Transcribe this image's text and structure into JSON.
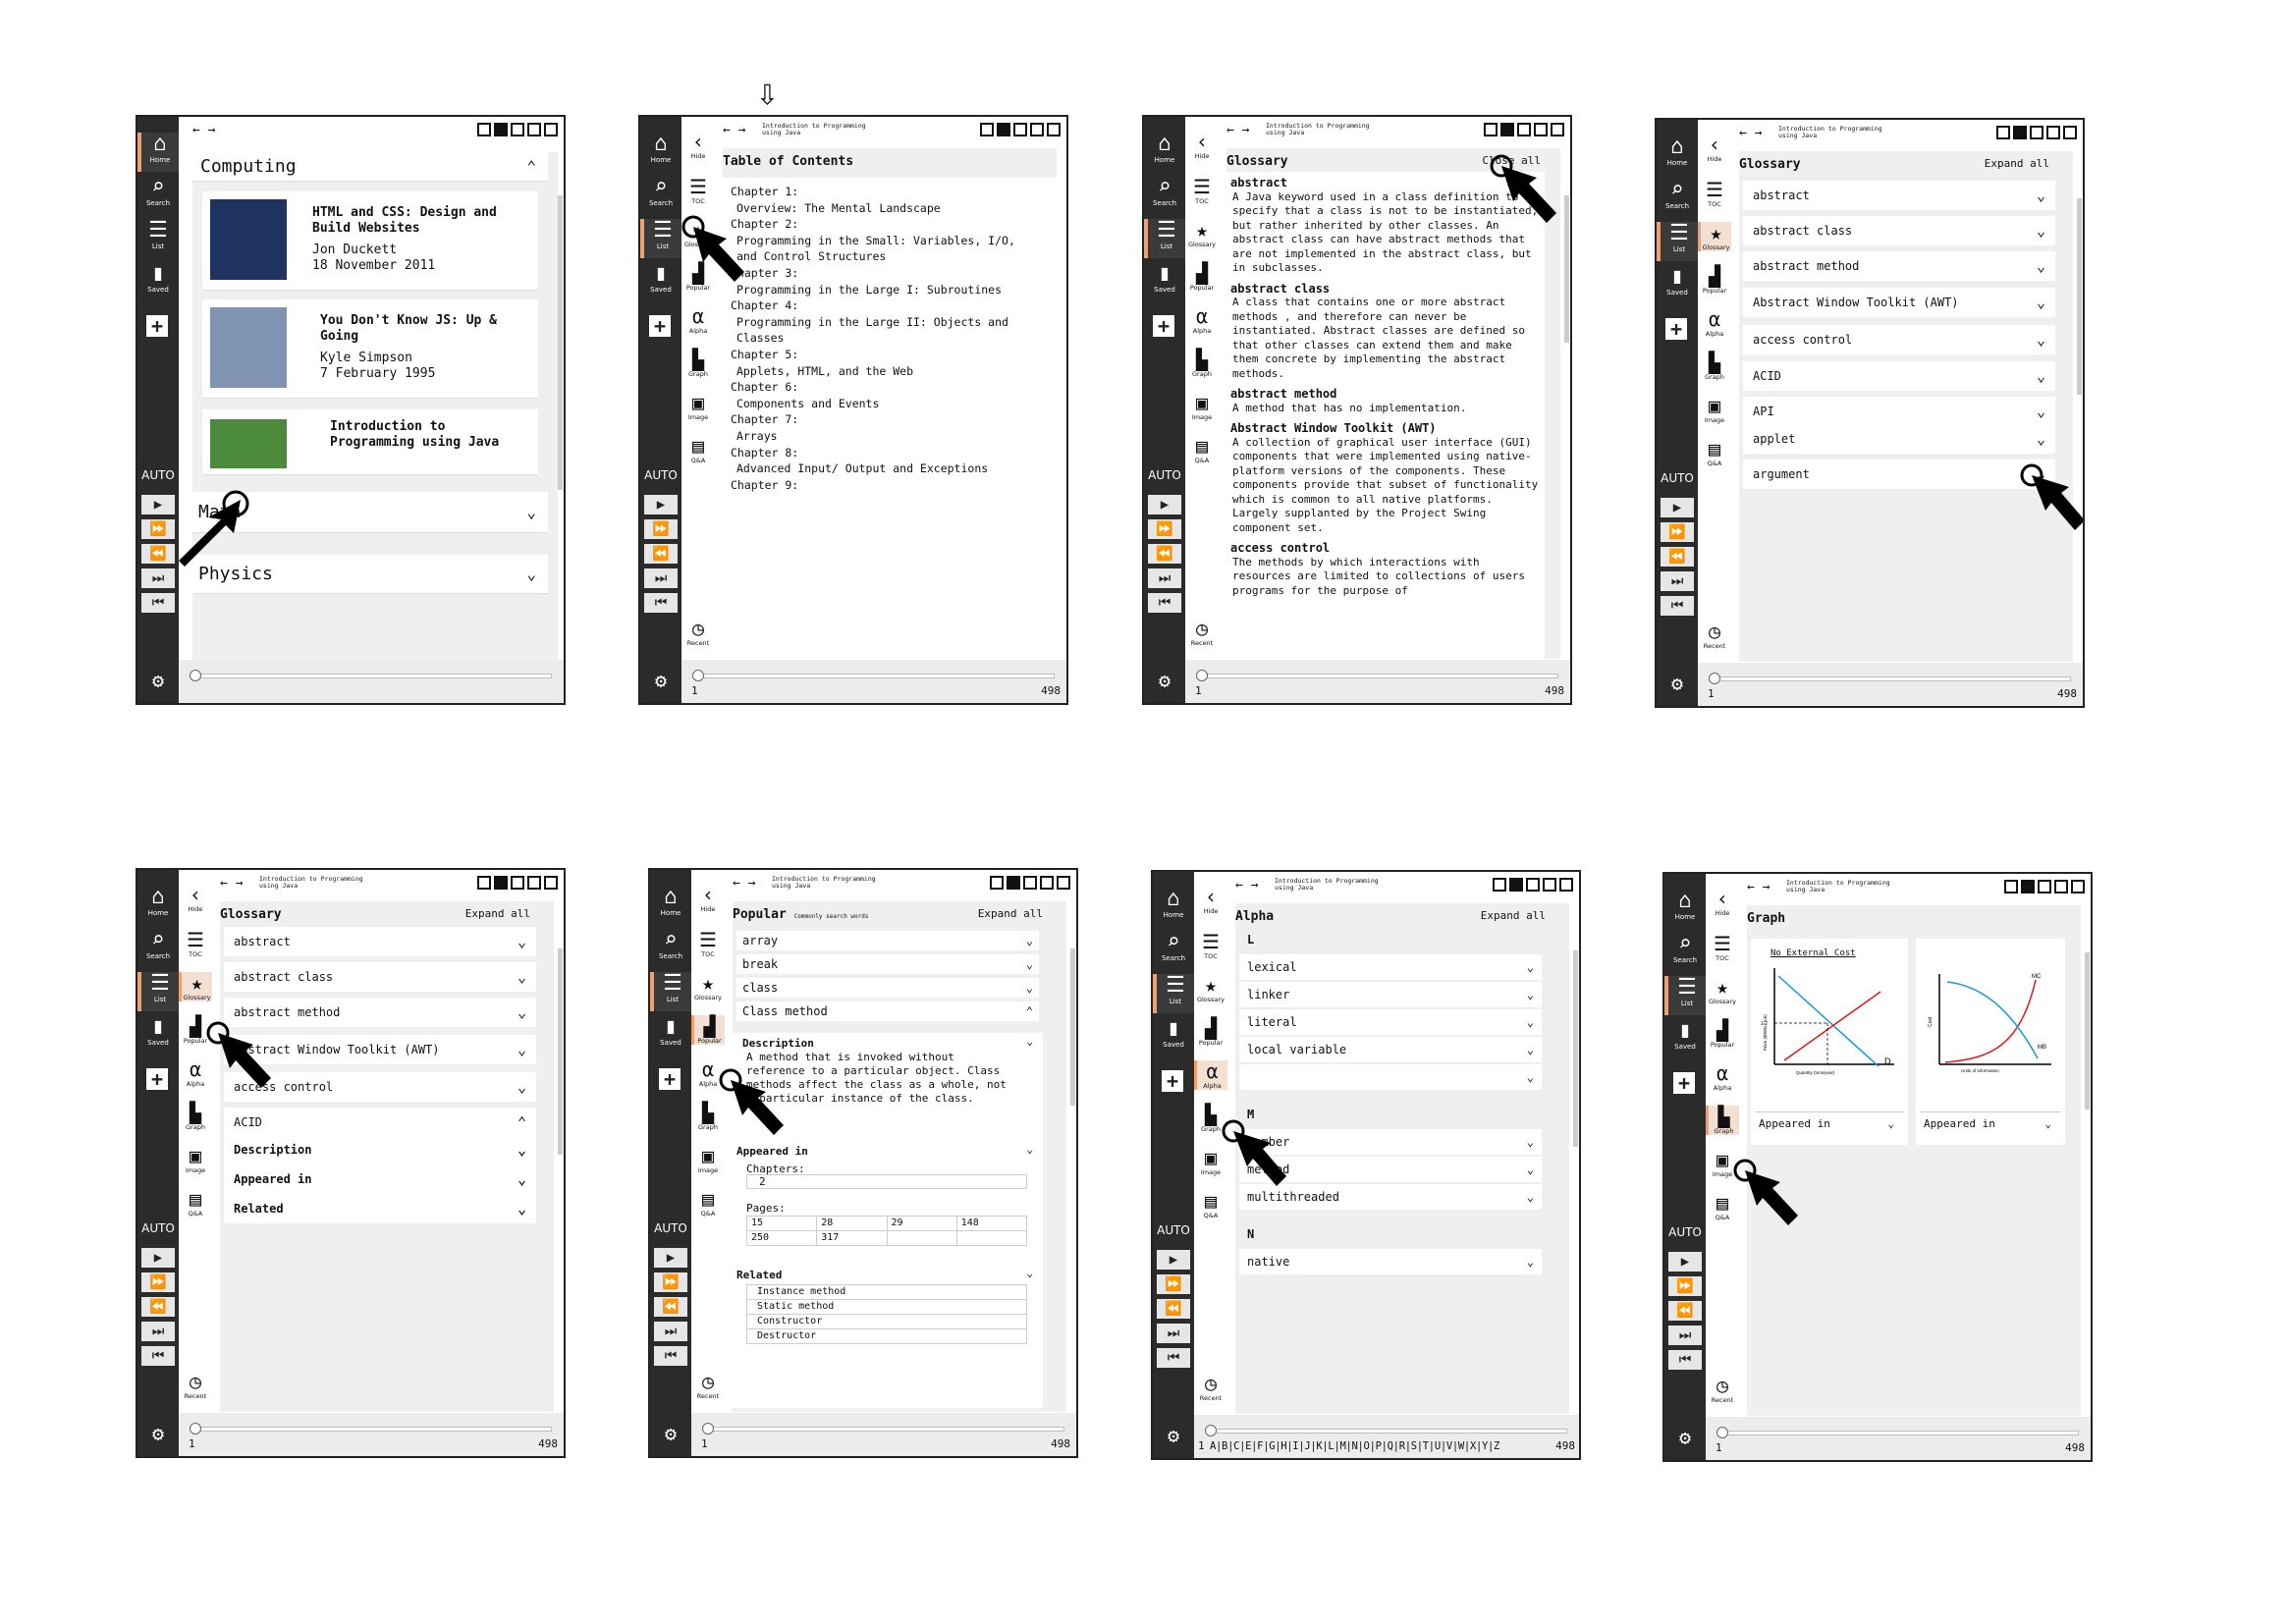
{
  "rail": {
    "home": "Home",
    "search": "Search",
    "list": "List",
    "saved": "Saved",
    "auto": "AUTO"
  },
  "subnav": {
    "hide": "Hide",
    "toc": "TOC",
    "glossary": "Glossary",
    "popular": "Popular",
    "alpha": "Alpha",
    "graph": "Graph",
    "image": "Image",
    "qa": "Q&A",
    "recent": "Recent"
  },
  "pages": {
    "first": "1",
    "last": "498"
  },
  "crumb": "Introduction to Programming using Java",
  "expand_all": "Expand all",
  "close_all": "Close all",
  "p1": {
    "section1": "Computing",
    "section2": "Math",
    "section3": "Physics",
    "books": [
      {
        "title": "HTML and CSS: Design and Build Websites",
        "author": "Jon Duckett",
        "date": "18 November 2011",
        "color": "#1f3361"
      },
      {
        "title": "You Don't Know JS: Up & Going",
        "author": "Kyle Simpson",
        "date": "7 February 1995",
        "color": "#8193b2"
      },
      {
        "title": "Introduction to Programming using Java",
        "author": "",
        "date": "",
        "color": "#4a8a3a"
      }
    ]
  },
  "p2": {
    "title": "Table of Contents",
    "items": [
      "Chapter 1:",
      "Overview: The Mental Landscape",
      "Chapter 2:",
      "Programming in the Small: Variables, I/O,",
      "and Control Structures",
      "Chapter 3:",
      "Programming in the Large I: Subroutines",
      "Chapter 4:",
      "Programming in the Large II: Objects and",
      "Classes",
      "Chapter 5:",
      "Applets, HTML, and the Web",
      "Chapter 6:",
      "Components and Events",
      "Chapter 7:",
      "Arrays",
      "Chapter 8:",
      "Advanced Input/ Output and Exceptions",
      "Chapter 9:"
    ]
  },
  "p3": {
    "title": "Glossary",
    "entries": [
      {
        "term": "abstract",
        "def": "A Java keyword used in a class definition to specify that a class is not to be instantiated, but rather inherited by other classes. An abstract class can have abstract methods that are not implemented in the abstract class, but in subclasses."
      },
      {
        "term": "abstract class",
        "def": "A class that contains one or more abstract methods , and therefore can never be instantiated. Abstract classes are defined so that other classes can extend them and make them concrete by implementing the abstract methods."
      },
      {
        "term": "abstract method",
        "def": "A method that has no implementation."
      },
      {
        "term": "Abstract Window Toolkit (AWT)",
        "def": "A collection of graphical user interface (GUI) components that were implemented using native-platform versions of the components. These components provide that subset of functionality which is common to all native platforms. Largely supplanted by the Project Swing component set."
      },
      {
        "term": "access control",
        "def": "The methods by which interactions with resources are limited to collections of users programs for the purpose of"
      }
    ]
  },
  "p4": {
    "title": "Glossary",
    "rows": [
      "abstract",
      "abstract class",
      "abstract method",
      "Abstract Window Toolkit (AWT)",
      "access control",
      "ACID",
      "API",
      "applet",
      "argument"
    ]
  },
  "p5": {
    "title": "Glossary",
    "rows": [
      "abstract",
      "abstract class",
      "abstract method",
      "Abstract Window Toolkit (AWT)",
      "access control",
      "ACID",
      "Description",
      "Appeared in",
      "Related"
    ]
  },
  "p6": {
    "title": "Popular",
    "subtitle": "Commonly search words",
    "rows": [
      "array",
      "break",
      "class",
      "Class method"
    ],
    "desc_label": "Description",
    "desc": "A method that is invoked without reference to a particular object. Class methods affect the class as a whole, not a particular instance of the class.",
    "appeared": "Appeared in",
    "chapters_label": "Chapters:",
    "chapter": "2",
    "pages_label": "Pages:",
    "pages_grid": [
      [
        "15",
        "28",
        "29",
        "148"
      ],
      [
        "250",
        "317",
        "",
        ""
      ]
    ],
    "related": "Related",
    "related_items": [
      "Instance method",
      "Static method",
      "Constructor",
      "Destructor"
    ]
  },
  "p7": {
    "title": "Alpha",
    "groups": [
      {
        "letter": "L",
        "rows": [
          "lexical",
          "linker",
          "literal",
          "local variable",
          ""
        ]
      },
      {
        "letter": "M",
        "rows": [
          "member",
          "method",
          "multithreaded"
        ]
      },
      {
        "letter": "N",
        "rows": [
          "native"
        ]
      }
    ],
    "alphabet": "A|B|C|E|F|G|H|I|J|K|L|M|N|O|P|Q|R|S|T|U|V|W|X|Y|Z"
  },
  "p8": {
    "title": "Graph",
    "card1_title": "No External Cost",
    "card1_ylabel": "Price ($000s / ton)",
    "card1_xlabel": "Quantity (tons/year)",
    "card1_d": "D",
    "card1_val": "1.2",
    "card2_ylabel": "Cost",
    "card2_xlabel": "Units of information",
    "card2_mc": "MC",
    "card2_mb": "MB",
    "appeared": "Appeared in"
  }
}
